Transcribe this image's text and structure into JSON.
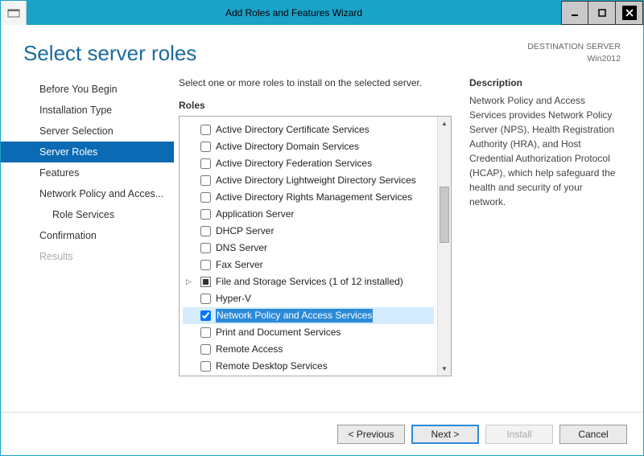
{
  "window": {
    "title": "Add Roles and Features Wizard"
  },
  "header": {
    "heading": "Select server roles",
    "dest_label": "DESTINATION SERVER",
    "dest_value": "Win2012"
  },
  "sidebar": {
    "items": [
      {
        "label": "Before You Begin",
        "state": "normal"
      },
      {
        "label": "Installation Type",
        "state": "normal"
      },
      {
        "label": "Server Selection",
        "state": "normal"
      },
      {
        "label": "Server Roles",
        "state": "selected"
      },
      {
        "label": "Features",
        "state": "normal"
      },
      {
        "label": "Network Policy and Acces...",
        "state": "normal"
      },
      {
        "label": "Role Services",
        "state": "normal",
        "sub": true
      },
      {
        "label": "Confirmation",
        "state": "normal"
      },
      {
        "label": "Results",
        "state": "disabled"
      }
    ]
  },
  "main": {
    "instruction": "Select one or more roles to install on the selected server.",
    "roles_label": "Roles",
    "roles": [
      {
        "label": "Active Directory Certificate Services",
        "checked": false
      },
      {
        "label": "Active Directory Domain Services",
        "checked": false
      },
      {
        "label": "Active Directory Federation Services",
        "checked": false
      },
      {
        "label": "Active Directory Lightweight Directory Services",
        "checked": false
      },
      {
        "label": "Active Directory Rights Management Services",
        "checked": false
      },
      {
        "label": "Application Server",
        "checked": false
      },
      {
        "label": "DHCP Server",
        "checked": false
      },
      {
        "label": "DNS Server",
        "checked": false
      },
      {
        "label": "Fax Server",
        "checked": false
      },
      {
        "label": "File and Storage Services (1 of 12 installed)",
        "checked": "partial",
        "expandable": true
      },
      {
        "label": "Hyper-V",
        "checked": false
      },
      {
        "label": "Network Policy and Access Services",
        "checked": true,
        "selected": true
      },
      {
        "label": "Print and Document Services",
        "checked": false
      },
      {
        "label": "Remote Access",
        "checked": false
      },
      {
        "label": "Remote Desktop Services",
        "checked": false
      }
    ],
    "desc_label": "Description",
    "desc_text": "Network Policy and Access Services provides Network Policy Server (NPS), Health Registration Authority (HRA), and Host Credential Authorization Protocol (HCAP), which help safeguard the health and security of your network."
  },
  "footer": {
    "previous": "< Previous",
    "next": "Next >",
    "install": "Install",
    "cancel": "Cancel"
  }
}
